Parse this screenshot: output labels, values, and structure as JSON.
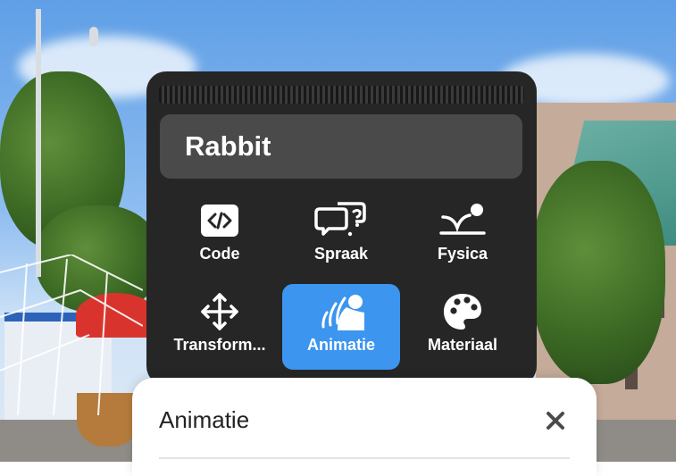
{
  "object_menu": {
    "object_name": "Rabbit",
    "tools": [
      {
        "label": "Code",
        "icon": "code-icon",
        "active": false
      },
      {
        "label": "Spraak",
        "icon": "speech-bubbles-icon",
        "active": false
      },
      {
        "label": "Fysica",
        "icon": "physics-icon",
        "active": false
      },
      {
        "label": "Transform...",
        "icon": "move-arrows-icon",
        "active": false
      },
      {
        "label": "Animatie",
        "icon": "animation-icon",
        "active": true
      },
      {
        "label": "Materiaal",
        "icon": "palette-icon",
        "active": false
      }
    ]
  },
  "bottom_sheet": {
    "title": "Animatie",
    "close_icon": "close-icon"
  },
  "colors": {
    "panel": "#262626",
    "active_accent": "#3c95ee",
    "name_field": "#4a4a4a"
  }
}
